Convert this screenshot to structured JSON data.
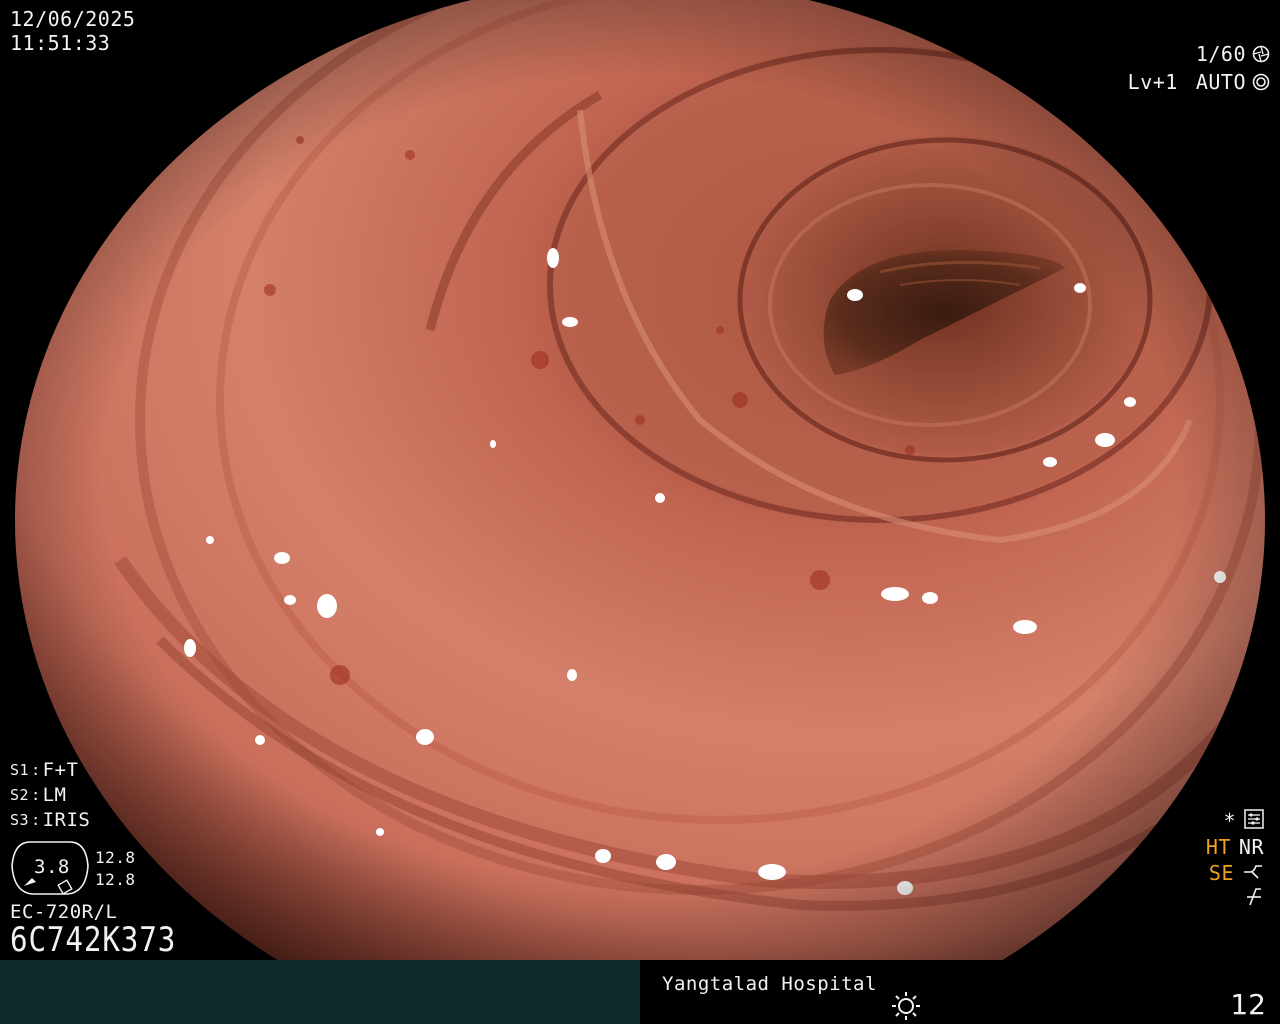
{
  "capture": {
    "date": "12/06/2025",
    "time": "11:51:33"
  },
  "camera": {
    "shutter": "1/60",
    "shutter_icon": "aperture-icon",
    "enhance_level": "Lv+1",
    "exposure_mode": "AUTO",
    "exposure_icon": "iris-mode-icon"
  },
  "switches": [
    {
      "key": "S1",
      "value": "F+T"
    },
    {
      "key": "S2",
      "value": "LM"
    },
    {
      "key": "S3",
      "value": "IRIS"
    }
  ],
  "iris": {
    "gauge_value": "3.8",
    "upper_value": "12.8",
    "lower_value": "12.8"
  },
  "scope": {
    "model": "EC-720R/L",
    "serial": "6C742K373"
  },
  "modes": {
    "star": "*",
    "settings_icon": "settings-icon",
    "ht": "HT",
    "nr": "NR",
    "se": "SE",
    "se_icon": "curve-icon",
    "freeze_icon": "freeze-off-icon"
  },
  "colors": {
    "status_active": "#f0a020",
    "status_bar_left": "#0f2a2a"
  },
  "footer": {
    "hospital": "Yangtalad Hospital",
    "light_icon": "sun-icon",
    "image_number": "12"
  }
}
